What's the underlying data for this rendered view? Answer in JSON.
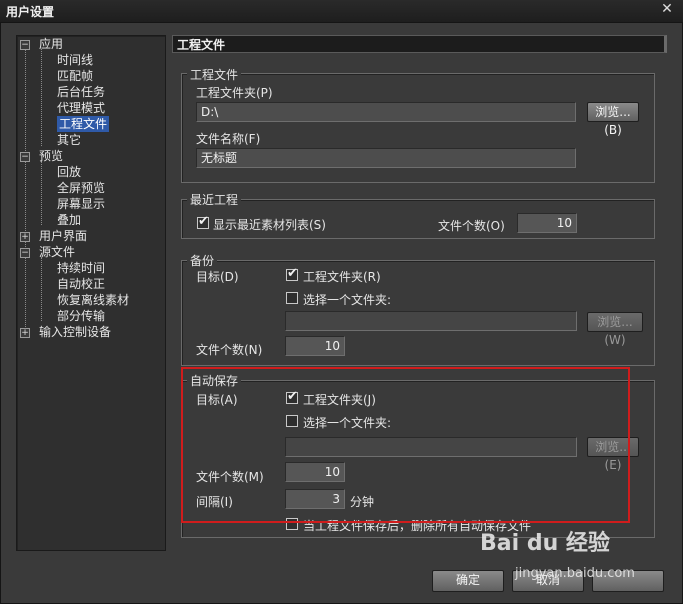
{
  "window": {
    "title": "用户设置",
    "close": "✕"
  },
  "tree": {
    "items": [
      {
        "label": "应用",
        "expander": "−"
      },
      {
        "label": "时间线"
      },
      {
        "label": "匹配帧"
      },
      {
        "label": "后台任务"
      },
      {
        "label": "代理模式"
      },
      {
        "label": "工程文件"
      },
      {
        "label": "其它"
      },
      {
        "label": "预览",
        "expander": "−"
      },
      {
        "label": "回放"
      },
      {
        "label": "全屏预览"
      },
      {
        "label": "屏幕显示"
      },
      {
        "label": "叠加"
      },
      {
        "label": "用户界面",
        "expander": "+"
      },
      {
        "label": "源文件",
        "expander": "−"
      },
      {
        "label": "持续时间"
      },
      {
        "label": "自动校正"
      },
      {
        "label": "恢复离线素材"
      },
      {
        "label": "部分传输"
      },
      {
        "label": "输入控制设备",
        "expander": "+"
      }
    ]
  },
  "header": {
    "title": "工程文件"
  },
  "project": {
    "legend": "工程文件",
    "folder_label": "工程文件夹(P)",
    "folder_value": "D:\\",
    "browse": "浏览...(B)",
    "name_label": "文件名称(F)",
    "name_value": "无标题"
  },
  "recent": {
    "legend": "最近工程",
    "show_label": "显示最近素材列表(S)",
    "count_label": "文件个数(O)",
    "count_value": "10"
  },
  "backup": {
    "legend": "备份",
    "target_label": "目标(D)",
    "opt1": "工程文件夹(R)",
    "opt2": "选择一个文件夹:",
    "browse": "浏览...(W)",
    "count_label": "文件个数(N)",
    "count_value": "10"
  },
  "autosave": {
    "legend": "自动保存",
    "target_label": "目标(A)",
    "opt1": "工程文件夹(J)",
    "opt2": "选择一个文件夹:",
    "browse": "浏览...(E)",
    "count_label": "文件个数(M)",
    "count_value": "10",
    "interval_label": "间隔(I)",
    "interval_value": "3",
    "interval_unit": "分钟",
    "delete_label": "当工程文件保存后，删除所有自动保存文件"
  },
  "footer": {
    "ok": "确定",
    "cancel": "取消"
  },
  "watermark": {
    "brand": "Bai du 经验",
    "url": "jingyan.baidu.com"
  }
}
